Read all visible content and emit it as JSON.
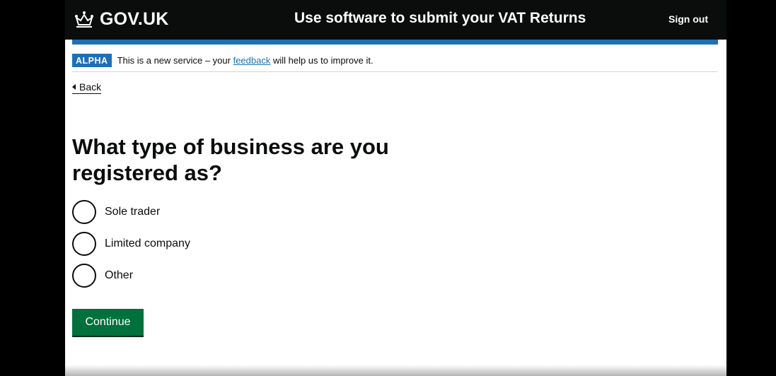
{
  "header": {
    "logo_text": "GOV.UK",
    "service_name": "Use software to submit your VAT Returns",
    "sign_out": "Sign out",
    "colors": {
      "background": "#0b0c0c",
      "accent_bar": "#1d70b8"
    }
  },
  "phase_banner": {
    "tag": "ALPHA",
    "text_before": "This is a new service – your ",
    "link": "feedback",
    "text_after": " will help us to improve it."
  },
  "back_link": {
    "label": "Back"
  },
  "question": {
    "heading": "What type of business are you registered as?",
    "options": [
      {
        "label": "Sole trader",
        "selected": false
      },
      {
        "label": "Limited company",
        "selected": false
      },
      {
        "label": "Other",
        "selected": false
      }
    ]
  },
  "actions": {
    "continue_label": "Continue",
    "button_color": "#00703c"
  },
  "icons": {
    "logo": "crown-icon",
    "back": "back-arrow-icon",
    "radio": "radio-unselected-icon"
  }
}
